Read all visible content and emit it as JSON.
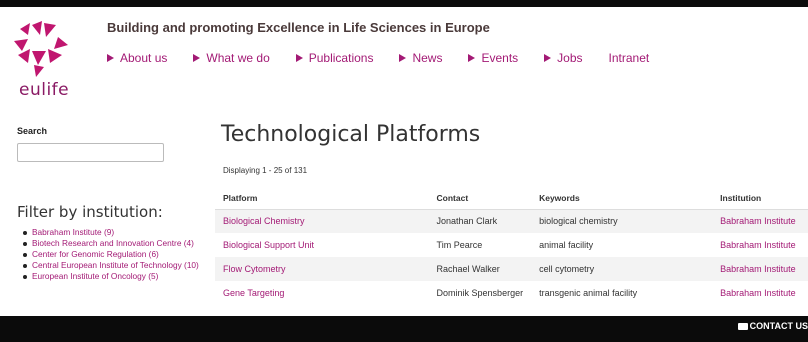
{
  "site": {
    "logo_text": "eulife",
    "tagline": "Building and promoting Excellence in Life Sciences in Europe"
  },
  "nav": [
    {
      "label": "About us",
      "chevron": true
    },
    {
      "label": "What we do",
      "chevron": true
    },
    {
      "label": "Publications",
      "chevron": true
    },
    {
      "label": "News",
      "chevron": true
    },
    {
      "label": "Events",
      "chevron": true
    },
    {
      "label": "Jobs",
      "chevron": true
    },
    {
      "label": "Intranet",
      "chevron": false
    }
  ],
  "search": {
    "label": "Search",
    "value": "",
    "placeholder": ""
  },
  "filter": {
    "title": "Filter by institution:",
    "items": [
      "Babraham Institute (9)",
      "Biotech Research and Innovation Centre (4)",
      "Center for Genomic Regulation (6)",
      "Central European Institute of Technology (10)",
      "European Institute of Oncology (5)"
    ]
  },
  "main": {
    "title": "Technological Platforms",
    "displaying": "Displaying 1 - 25 of 131",
    "columns": [
      "Platform",
      "Contact",
      "Keywords",
      "Institution"
    ],
    "rows": [
      [
        "Biological Chemistry",
        "Jonathan Clark",
        "biological chemistry",
        "Babraham Institute"
      ],
      [
        "Biological Support Unit",
        "Tim Pearce",
        "animal facility",
        "Babraham Institute"
      ],
      [
        "Flow Cytometry",
        "Rachael Walker",
        "cell cytometry",
        "Babraham Institute"
      ],
      [
        "Gene Targeting",
        "Dominik Spensberger",
        "transgenic animal facility",
        "Babraham Institute"
      ]
    ]
  },
  "footer": {
    "contact_label": "CONTACT US"
  },
  "colors": {
    "brand": "#a31a75",
    "bar": "#0b0b0b"
  }
}
